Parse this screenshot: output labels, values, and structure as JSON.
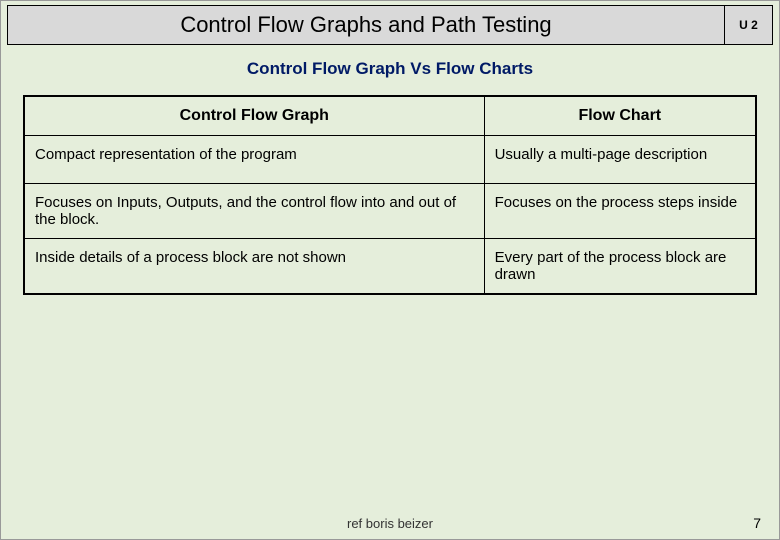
{
  "header": {
    "title": "Control Flow Graphs and Path Testing",
    "unit": "U 2"
  },
  "subtitle": "Control Flow Graph Vs Flow Charts",
  "table": {
    "columns": [
      "Control Flow Graph",
      "Flow Chart"
    ],
    "rows": [
      {
        "left": "Compact representation of the program",
        "right": "Usually a multi-page description"
      },
      {
        "left": "Focuses on Inputs, Outputs, and the control flow into and out of the block.",
        "right": "Focuses on the process steps inside"
      },
      {
        "left": "Inside details of a process block are not shown",
        "right": "Every part of the process block are drawn"
      }
    ]
  },
  "footer": {
    "ref": "ref boris beizer",
    "page": "7"
  }
}
